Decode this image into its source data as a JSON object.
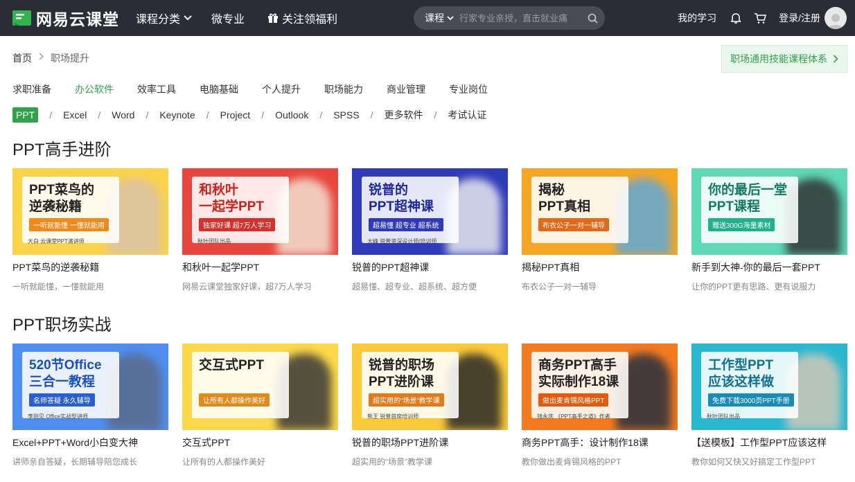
{
  "header": {
    "logo": "网易云课堂",
    "nav": [
      "课程分类",
      "微专业",
      "关注领福利"
    ],
    "search_category": "课程",
    "search_placeholder": "行家专业亲授，直击就业痛",
    "my_study": "我的学习",
    "login": "登录/注册"
  },
  "breadcrumb": {
    "home": "首页",
    "current": "职场提升"
  },
  "system_link": "职场通用技能课程体系",
  "categories": [
    "求职准备",
    "办公软件",
    "效率工具",
    "电脑基础",
    "个人提升",
    "职场能力",
    "商业管理",
    "专业岗位"
  ],
  "subcategories": [
    "PPT",
    "Excel",
    "Word",
    "Keynote",
    "Project",
    "Outlook",
    "SPSS",
    "更多软件",
    "考试认证"
  ],
  "colors": {
    "brand_green": "#2fa24a",
    "header_bg": "#2b2d36"
  },
  "sections": [
    {
      "title": "PPT高手进阶",
      "courses": [
        {
          "title": "PPT菜鸟的逆袭秘籍",
          "subtitle": "一听就能懂，一懂就能用",
          "thumb_title": "PPT菜鸟的\n逆袭秘籍",
          "thumb_tag": "一听就能懂 一懂就能用",
          "thumb_foot": "大白  云课堂PPT演讲师",
          "bg": "#fcd24a",
          "accent": "#f08a1c",
          "title_color": "#222",
          "fig": "#d9c3a8"
        },
        {
          "title": "和秋叶一起学PPT",
          "subtitle": "网易云课堂独家好课，超7万人学习",
          "thumb_title": "和秋叶\n一起学PPT",
          "thumb_tag": "独家好课 超7万人学习",
          "thumb_foot": "秋叶团队出品",
          "bg": "#e8463c",
          "accent": "#d6302a",
          "title_color": "#c8231b",
          "fig": "#f2e0d2"
        },
        {
          "title": "锐普的PPT超神课",
          "subtitle": "超易懂、超专业、超系统、超方便",
          "thumb_title": "锐普的\nPPT超神课",
          "thumb_tag": "超易懂 超专业 超系统",
          "thumb_foot": "大峰  锐普资深设计师/培训师",
          "bg": "#2f3ab8",
          "accent": "#2f3ab8",
          "title_color": "#1d27a0",
          "fig": "#e8e8ee"
        },
        {
          "title": "揭秘PPT真相",
          "subtitle": "布衣公子一对一辅导",
          "thumb_title": "揭秘\nPPT真相",
          "thumb_tag": "布衣公子一对一辅导",
          "thumb_foot": "",
          "bg": "#f5a623",
          "accent": "#e06a1a",
          "title_color": "#222",
          "fig": "#5fa8d9"
        },
        {
          "title": "新手到大神-你的最后一套PPT",
          "subtitle": "让你的PPT更有思路、更有说服力",
          "thumb_title": "你的最后一堂\nPPT课程",
          "thumb_tag": "赠送300G海量素材",
          "thumb_foot": "",
          "bg": "#5fd8b6",
          "accent": "#20b08a",
          "title_color": "#127a5e",
          "fig": "#333333"
        }
      ]
    },
    {
      "title": "PPT职场实战",
      "courses": [
        {
          "title": "Excel+PPT+Word小白变大神",
          "subtitle": "讲师亲自答疑，长期辅导陪您成长",
          "thumb_title": "520节Office\n三合一教程",
          "thumb_tag": "名师答疑 永久辅导",
          "thumb_foot": "李则见  Office实战型讲师",
          "bg": "#4f8ef0",
          "accent": "#2a5fd0",
          "title_color": "#1b4fc0",
          "fig": "#5a6a8a"
        },
        {
          "title": "交互式PPT",
          "subtitle": "让所有的人都操作美好",
          "thumb_title": "交互式PPT",
          "thumb_tag": "让所有人都操作美好",
          "thumb_foot": "",
          "bg": "#fcd84a",
          "accent": "#e08a1c",
          "title_color": "#222",
          "fig": "#3a3a3a"
        },
        {
          "title": "锐普的职场PPT进阶课",
          "subtitle": "超实用的“场景”教学课",
          "thumb_title": "锐普的职场\nPPT进阶课",
          "thumb_tag": "超实用的“场景”教学课",
          "thumb_foot": "熊王  锐普首席培训师",
          "bg": "#fcc93a",
          "accent": "#e07a1a",
          "title_color": "#222",
          "fig": "#2a2a2a"
        },
        {
          "title": "商务PPT高手：设计制作18课",
          "subtitle": "教你做出麦肯锡风格的PPT",
          "thumb_title": "商务PPT高手\n实际制作18课",
          "thumb_tag": "做出麦肯锡风格PPT",
          "thumb_foot": "钱永庆 《PPT高手之道》作者",
          "bg": "#f47a20",
          "accent": "#e05a10",
          "title_color": "#222",
          "fig": "#2a3040"
        },
        {
          "title": "【送模板】工作型PPT应该这样",
          "subtitle": "教你如何又快又好搞定工作型PPT",
          "thumb_title": "工作型PPT\n应该这样做",
          "thumb_tag": "免费下载3000页PPT手册",
          "thumb_foot": "秋叶团队出品",
          "bg": "#2ab8d0",
          "accent": "#1a8ab8",
          "title_color": "#107090",
          "fig": "#d0c8b8"
        }
      ]
    }
  ]
}
